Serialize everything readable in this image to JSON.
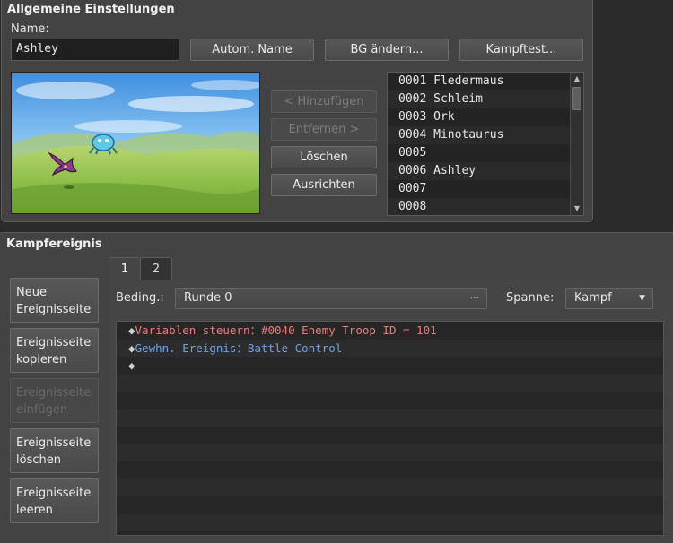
{
  "general": {
    "title": "Allgemeine Einstellungen",
    "name_label": "Name:",
    "name_value": "Ashley",
    "auto_name_button": "Autom. Name",
    "change_bg_button": "BG ändern...",
    "battle_test_button": "Kampftest...",
    "add_button": "< Hinzufügen",
    "remove_button": "Entfernen >",
    "delete_button": "Löschen",
    "align_button": "Ausrichten",
    "enemy_list": [
      "0001 Fledermaus",
      "0002 Schleim",
      "0003 Ork",
      "0004 Minotaurus",
      "0005",
      "0006 Ashley",
      "0007",
      "0008"
    ]
  },
  "battle_event": {
    "title": "Kampfereignis",
    "side_buttons": [
      "Neue\nEreignisseite",
      "Ereignisseite\nkopieren",
      "Ereignisseite\neinfügen",
      "Ereignisseite\nlöschen",
      "Ereignisseite\nleeren"
    ],
    "tabs": [
      "1",
      "2"
    ],
    "condition_label": "Beding.:",
    "condition_value": "Runde 0",
    "condition_ellipsis": "···",
    "span_label": "Spanne:",
    "span_value": "Kampf",
    "commands": [
      {
        "diamond": "◆",
        "text": "Variablen steuern：#0040 Enemy Troop ID = 101",
        "color": "#ec7c7c"
      },
      {
        "diamond": "◆",
        "text": "Gewhn. Ereignis：Battle Control",
        "color": "#6fa2e6"
      },
      {
        "diamond": "◆",
        "text": ""
      }
    ]
  },
  "icons": {
    "scroll_up": "scroll-up-arrow-icon",
    "scroll_down": "scroll-down-arrow-icon",
    "dropdown": "chevron-down-icon",
    "diamond": "diamond-icon"
  }
}
